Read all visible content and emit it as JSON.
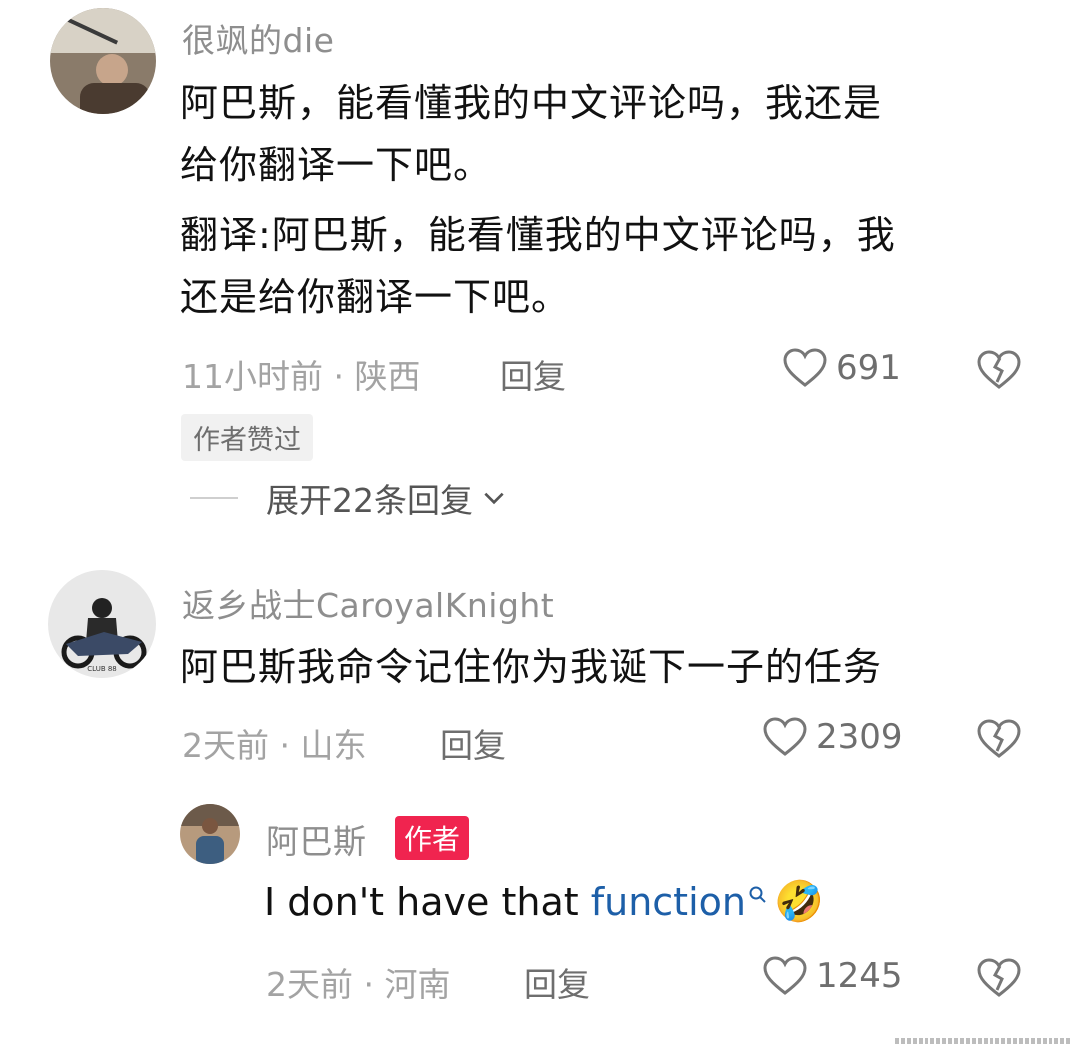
{
  "comments": [
    {
      "username": "很飒的die",
      "text_lines": [
        "阿巴斯，能看懂我的中文评论吗，我还是",
        "给你翻译一下吧。",
        "翻译:阿巴斯，能看懂我的中文评论吗，我",
        "还是给你翻译一下吧。"
      ],
      "meta": "11小时前 · 陕西",
      "reply_label": "回复",
      "likes": "691",
      "badge": "作者赞过",
      "expand_label": "展开22条回复"
    },
    {
      "username": "返乡战士CaroyalKnight",
      "text": "阿巴斯我命令记住你为我诞下一子的任务",
      "meta": "2天前 · 山东",
      "reply_label": "回复",
      "likes": "2309"
    }
  ],
  "reply": {
    "username": "阿巴斯",
    "author_badge": "作者",
    "text_plain": "I don't have that ",
    "text_link": "function",
    "emoji": "🤣",
    "meta": "2天前 · 河南",
    "reply_label": "回复",
    "likes": "1245"
  },
  "colors": {
    "author_badge": "#f0244f",
    "link": "#1d5fa8",
    "muted": "#a3a3a3"
  },
  "icons": [
    "heart-outline-icon",
    "broken-heart-icon",
    "chevron-down-icon",
    "search-icon"
  ]
}
